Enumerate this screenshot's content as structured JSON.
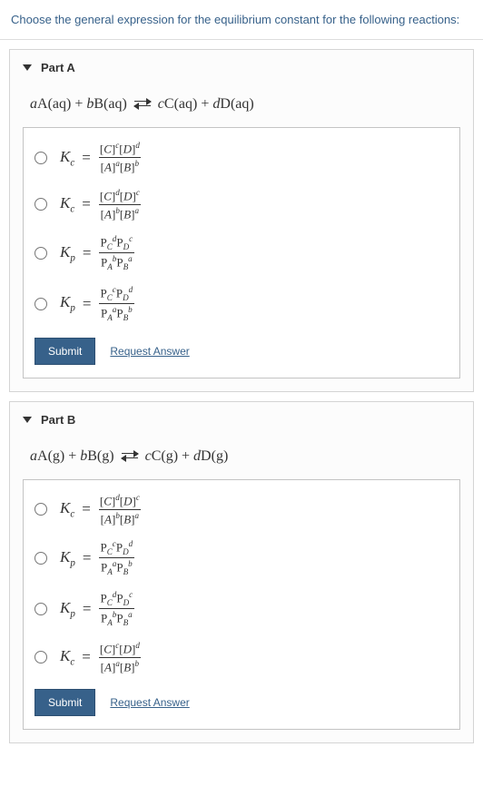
{
  "instruction": "Choose the general expression for the equilibrium constant for the following reactions:",
  "partA": {
    "header": "Part A",
    "reaction": {
      "lhs1_coef": "a",
      "lhs1_sp": "A",
      "lhs1_ph": "(aq)",
      "plus1": " + ",
      "lhs2_coef": "b",
      "lhs2_sp": "B",
      "lhs2_ph": "(aq)",
      "rhs1_coef": "c",
      "rhs1_sp": "C",
      "rhs1_ph": "(aq)",
      "plus2": " + ",
      "rhs2_coef": "d",
      "rhs2_sp": "D",
      "rhs2_ph": "(aq)"
    },
    "options": {
      "o1": {
        "sym": "K",
        "sub": "c",
        "num": "[C]ᶜ[D]ᵈ",
        "den": "[A]ᵃ[B]ᵇ"
      },
      "o2": {
        "sym": "K",
        "sub": "c",
        "num": "[C]ᵈ[D]ᶜ",
        "den": "[A]ᵇ[B]ᵃ"
      },
      "o3": {
        "sym": "K",
        "sub": "p",
        "num": "P_C^d P_D^c",
        "den": "P_A^b P_B^a"
      },
      "o4": {
        "sym": "K",
        "sub": "p",
        "num": "P_C^c P_D^d",
        "den": "P_A^a P_B^b"
      }
    },
    "submit": "Submit",
    "request": "Request Answer"
  },
  "partB": {
    "header": "Part B",
    "reaction": {
      "lhs1_coef": "a",
      "lhs1_sp": "A",
      "lhs1_ph": "(g)",
      "plus1": " + ",
      "lhs2_coef": "b",
      "lhs2_sp": "B",
      "lhs2_ph": "(g)",
      "rhs1_coef": "c",
      "rhs1_sp": "C",
      "rhs1_ph": "(g)",
      "plus2": " + ",
      "rhs2_coef": "d",
      "rhs2_sp": "D",
      "rhs2_ph": "(g)"
    },
    "options": {
      "o1": {
        "sym": "K",
        "sub": "c",
        "num": "[C]ᵈ[D]ᶜ",
        "den": "[A]ᵇ[B]ᵃ"
      },
      "o2": {
        "sym": "K",
        "sub": "p",
        "num": "P_C^c P_D^d",
        "den": "P_A^a P_B^b"
      },
      "o3": {
        "sym": "K",
        "sub": "p",
        "num": "P_C^d P_D^c",
        "den": "P_A^b P_B^a"
      },
      "o4": {
        "sym": "K",
        "sub": "c",
        "num": "[C]ᶜ[D]ᵈ",
        "den": "[A]ᵃ[B]ᵇ"
      }
    },
    "submit": "Submit",
    "request": "Request Answer"
  }
}
